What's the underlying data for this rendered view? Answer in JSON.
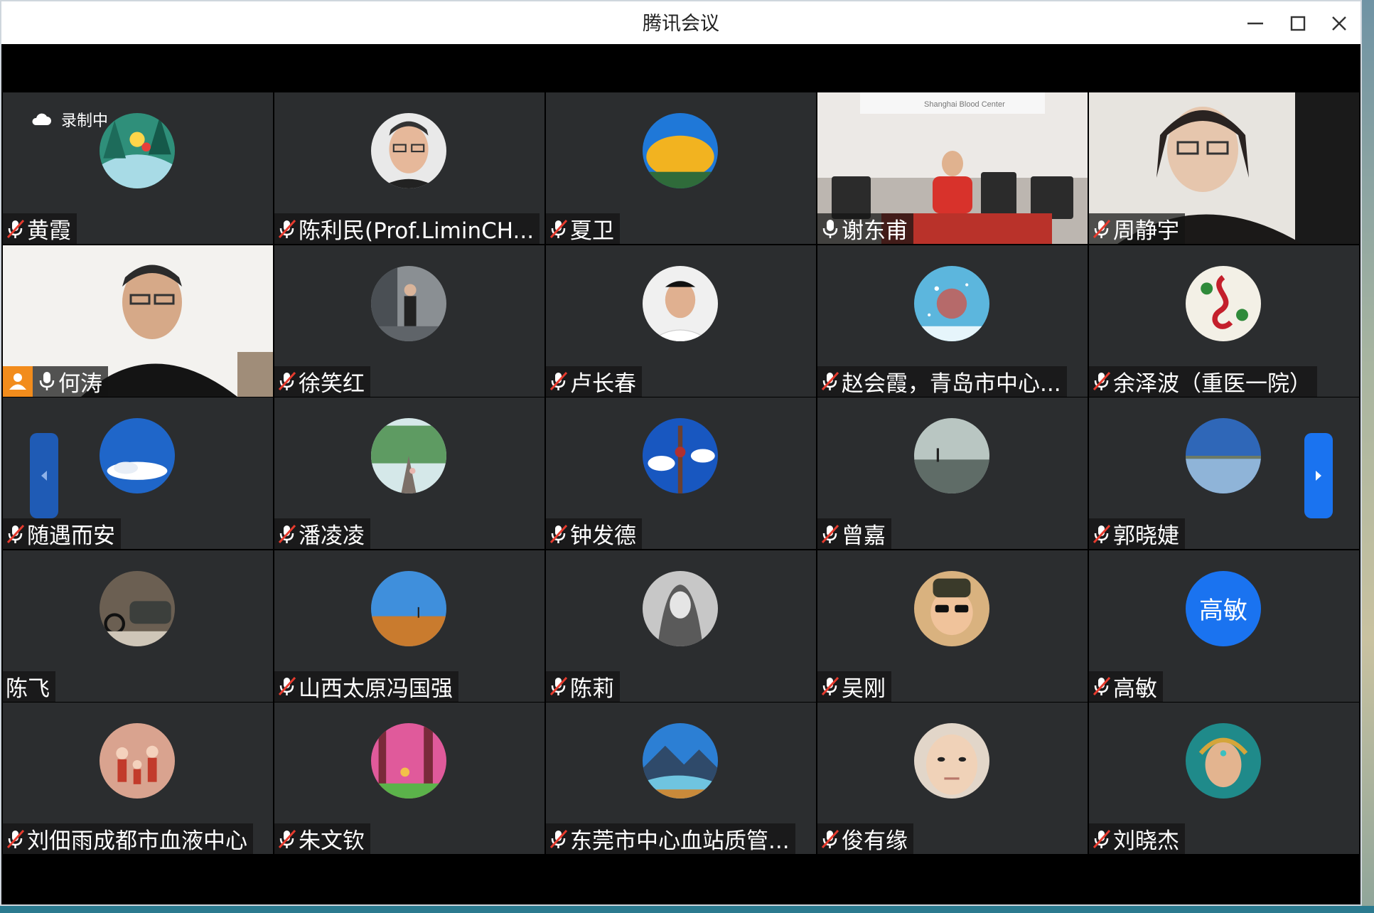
{
  "window": {
    "title": "腾讯会议"
  },
  "recording": {
    "label": "录制中"
  },
  "participants": [
    {
      "name": "黄霞",
      "mic": "muted",
      "avatar": "flower-illustration",
      "media": "avatar"
    },
    {
      "name": "陈利民(Prof.LiminCH...",
      "mic": "muted",
      "avatar": "man-glasses-portrait",
      "media": "avatar"
    },
    {
      "name": "夏卫",
      "mic": "muted",
      "avatar": "golden-tree",
      "media": "avatar"
    },
    {
      "name": "谢东甫",
      "mic": "on",
      "avatar": "",
      "media": "video"
    },
    {
      "name": "周静宇",
      "mic": "muted",
      "avatar": "",
      "media": "video"
    },
    {
      "name": "何涛",
      "mic": "on",
      "avatar": "",
      "media": "video",
      "active": true
    },
    {
      "name": "徐笑红",
      "mic": "muted",
      "avatar": "woman-standing",
      "media": "avatar"
    },
    {
      "name": "卢长春",
      "mic": "muted",
      "avatar": "doctor-portrait",
      "media": "avatar"
    },
    {
      "name": "赵会霞，青岛市中心...",
      "mic": "muted",
      "avatar": "blue-snow-poster",
      "media": "avatar"
    },
    {
      "name": "余泽波（重医一院）",
      "mic": "muted",
      "avatar": "treble-clef",
      "media": "avatar"
    },
    {
      "name": "随遇而安",
      "mic": "muted",
      "avatar": "blue-sky",
      "media": "avatar"
    },
    {
      "name": "潘凌凌",
      "mic": "muted",
      "avatar": "railway-trees",
      "media": "avatar"
    },
    {
      "name": "钟发德",
      "mic": "muted",
      "avatar": "tv-tower",
      "media": "avatar"
    },
    {
      "name": "曾嘉",
      "mic": "muted",
      "avatar": "lake-figure",
      "media": "avatar"
    },
    {
      "name": "郭晓婕",
      "mic": "muted",
      "avatar": "calm-water",
      "media": "avatar"
    },
    {
      "name": "陈飞",
      "mic": "none",
      "avatar": "car-motorcycle",
      "media": "avatar"
    },
    {
      "name": "山西太原冯国强",
      "mic": "muted",
      "avatar": "desert-figure",
      "media": "avatar"
    },
    {
      "name": "陈莉",
      "mic": "muted",
      "avatar": "sketch-girl",
      "media": "avatar"
    },
    {
      "name": "吴刚",
      "mic": "muted",
      "avatar": "child-sunglasses",
      "media": "avatar"
    },
    {
      "name": "高敏",
      "mic": "muted",
      "avatar": "text",
      "avatar_text": "高敏",
      "media": "avatar"
    },
    {
      "name": "刘佃雨成都市血液中心",
      "mic": "muted",
      "avatar": "family-illustration",
      "media": "avatar"
    },
    {
      "name": "朱文钦",
      "mic": "muted",
      "avatar": "pink-trees-painting",
      "media": "avatar"
    },
    {
      "name": "东莞市中心血站质管...",
      "mic": "muted",
      "avatar": "mountain-river",
      "media": "avatar"
    },
    {
      "name": "俊有缘",
      "mic": "muted",
      "avatar": "face-closeup",
      "media": "avatar"
    },
    {
      "name": "刘晓杰",
      "mic": "muted",
      "avatar": "jeweled-woman",
      "media": "avatar"
    }
  ],
  "colors": {
    "tile_bg": "#2b2d2f",
    "accent_blue": "#1a73f0",
    "active_border": "#2f9b4a",
    "person_badge": "#f28c1c"
  }
}
